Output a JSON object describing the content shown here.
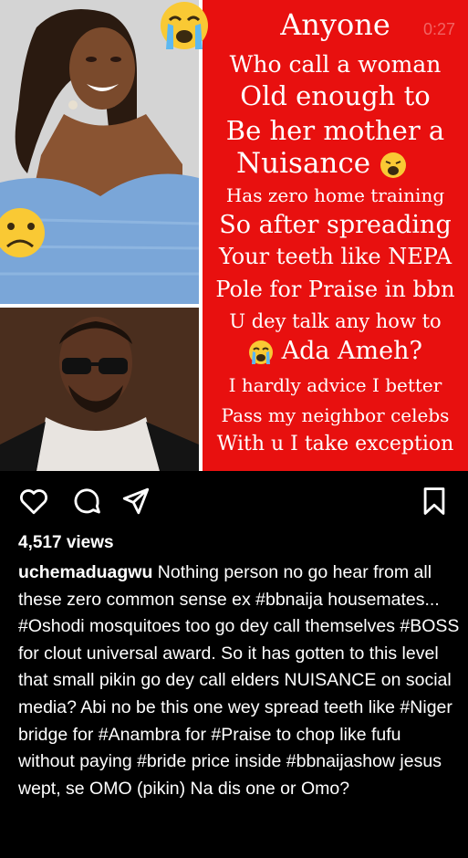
{
  "post": {
    "timer": "0:27",
    "caption_lines": [
      "Anyone",
      "Who call a woman",
      "Old enough to",
      "Be her mother a",
      "Nuisance",
      "Has zero home training",
      "So after spreading",
      "Your teeth like NEPA",
      "Pole for Praise in bbn",
      "U dey talk any how to",
      "Ada Ameh?",
      "I hardly advice I better",
      "Pass my neighbor celebs",
      "With u I take exception"
    ]
  },
  "actions": {
    "like_icon": "heart-icon",
    "comment_icon": "comment-icon",
    "share_icon": "share-icon",
    "save_icon": "bookmark-icon"
  },
  "stats": {
    "views": "4,517 views"
  },
  "caption": {
    "username": "uchemaduagwu",
    "text": "Nothing person no go hear from all these zero common sense ex #bbnaija housemates... #Oshodi mosquitoes too go dey call themselves #BOSS for clout universal award. So it has gotten to this level that small pikin go dey call elders NUISANCE on social media? Abi no be this one wey spread teeth like #Niger bridge for #Anambra for #Praise to chop like fufu without paying #bride price inside #bbnaijashow jesus wept, se OMO (pikin) Na dis one or Omo?"
  },
  "colors": {
    "panel_red": "#e8100f",
    "background": "#000000",
    "text": "#ffffff"
  }
}
